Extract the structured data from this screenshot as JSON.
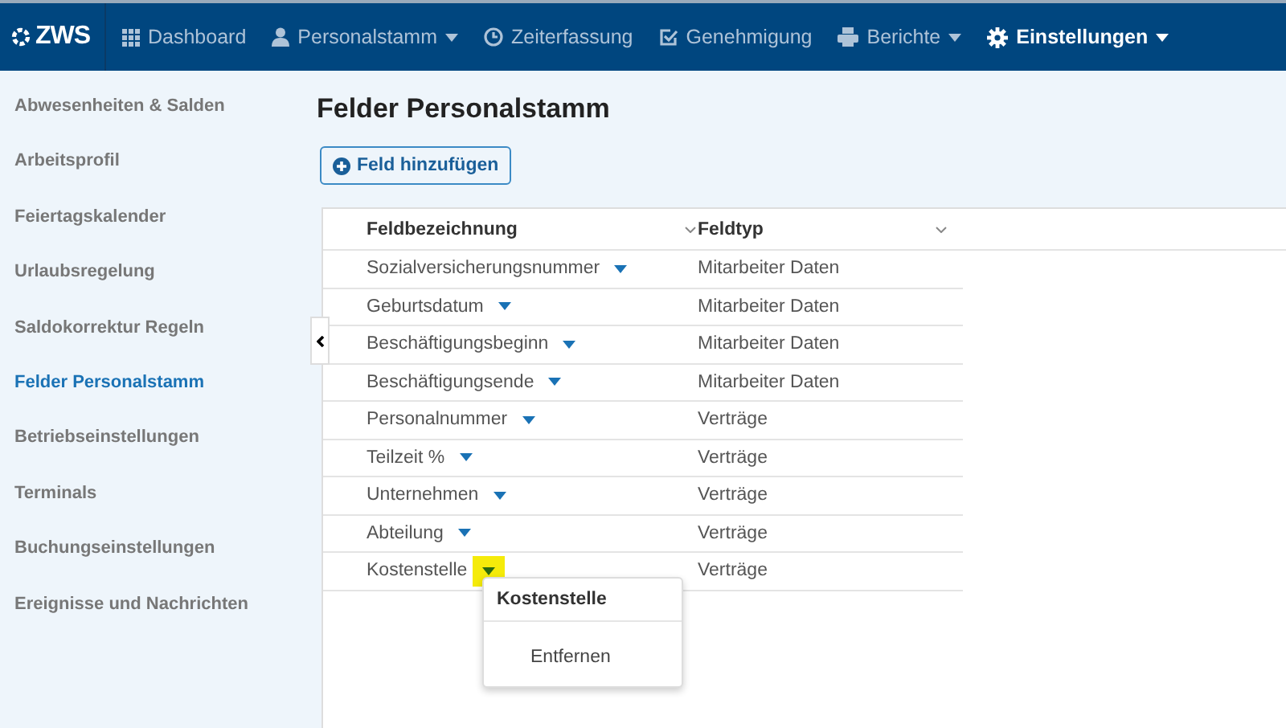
{
  "brand": "ZWS",
  "nav": [
    {
      "label": "Dashboard",
      "kind": "grid",
      "caret": false,
      "selected": false
    },
    {
      "label": "Personalstamm",
      "kind": "user",
      "caret": true,
      "selected": false
    },
    {
      "label": "Zeiterfassung",
      "kind": "clock",
      "caret": false,
      "selected": false
    },
    {
      "label": "Genehmigung",
      "kind": "check",
      "caret": false,
      "selected": false
    },
    {
      "label": "Berichte",
      "kind": "print",
      "caret": true,
      "selected": false
    },
    {
      "label": "Einstellungen",
      "kind": "gear",
      "caret": true,
      "selected": true
    }
  ],
  "sidebar": {
    "items": [
      {
        "label": "Abwesenheiten & Salden",
        "selected": false
      },
      {
        "label": "Arbeitsprofil",
        "selected": false
      },
      {
        "label": "Feiertagskalender",
        "selected": false
      },
      {
        "label": "Urlaubsregelung",
        "selected": false
      },
      {
        "label": "Saldokorrektur Regeln",
        "selected": false
      },
      {
        "label": "Felder Personalstamm",
        "selected": true
      },
      {
        "label": "Betriebseinstellungen",
        "selected": false
      },
      {
        "label": "Terminals",
        "selected": false
      },
      {
        "label": "Buchungseinstellungen",
        "selected": false
      },
      {
        "label": "Ereignisse und Nachrichten",
        "selected": false
      }
    ]
  },
  "page_title": "Felder Personalstamm",
  "add_button": "Feld hinzufügen",
  "table": {
    "columns": [
      "Feldbezeichnung",
      "Feldtyp"
    ],
    "rows": [
      {
        "name": "Sozialversicherungsnummer",
        "type": "Mitarbeiter Daten",
        "highlighted": false
      },
      {
        "name": "Geburtsdatum",
        "type": "Mitarbeiter Daten",
        "highlighted": false
      },
      {
        "name": "Beschäftigungsbeginn",
        "type": "Mitarbeiter Daten",
        "highlighted": false
      },
      {
        "name": "Beschäftigungsende",
        "type": "Mitarbeiter Daten",
        "highlighted": false
      },
      {
        "name": "Personalnummer",
        "type": "Verträge",
        "highlighted": false
      },
      {
        "name": "Teilzeit %",
        "type": "Verträge",
        "highlighted": false
      },
      {
        "name": "Unternehmen",
        "type": "Verträge",
        "highlighted": false
      },
      {
        "name": "Abteilung",
        "type": "Verträge",
        "highlighted": false
      },
      {
        "name": "Kostenstelle",
        "type": "Verträge",
        "highlighted": true
      }
    ]
  },
  "context_menu": {
    "title": "Kostenstelle",
    "items": [
      "Entfernen"
    ]
  }
}
